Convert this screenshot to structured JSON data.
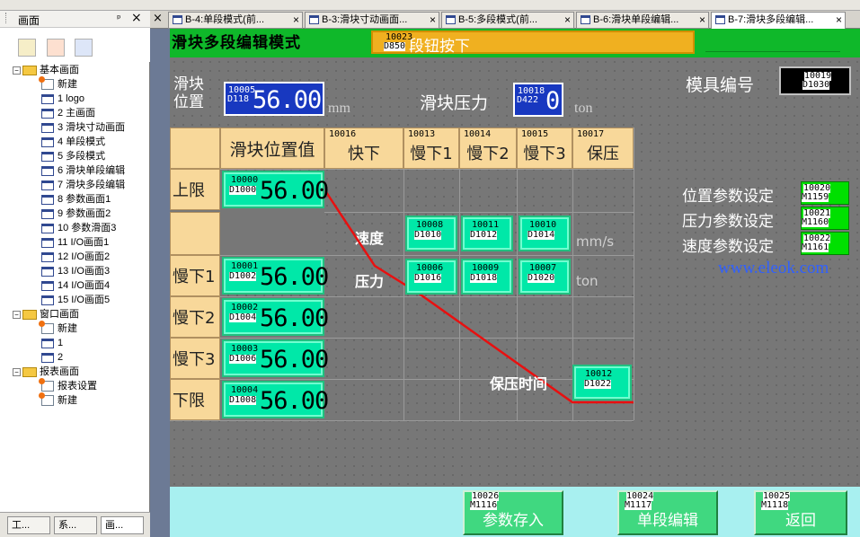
{
  "left_panel": {
    "title": "画面",
    "pin": "ᵖ",
    "close": "×",
    "tree": [
      {
        "label": "基本画面",
        "kind": "folder",
        "level": 0,
        "expander": "⊟"
      },
      {
        "label": "新建",
        "kind": "new",
        "level": 1
      },
      {
        "label": "1 logo",
        "kind": "page",
        "level": 1
      },
      {
        "label": "2 主画面",
        "kind": "page",
        "level": 1
      },
      {
        "label": "3 滑块寸动画面",
        "kind": "page",
        "level": 1
      },
      {
        "label": "4 单段模式",
        "kind": "page",
        "level": 1
      },
      {
        "label": "5 多段模式",
        "kind": "page",
        "level": 1
      },
      {
        "label": "6 滑块单段编辑",
        "kind": "page",
        "level": 1
      },
      {
        "label": "7 滑块多段编辑",
        "kind": "page",
        "level": 1
      },
      {
        "label": "8 参数画面1",
        "kind": "page",
        "level": 1
      },
      {
        "label": "9 参数画面2",
        "kind": "page",
        "level": 1
      },
      {
        "label": "10 参数滑面3",
        "kind": "page",
        "level": 1
      },
      {
        "label": "11 I/O画面1",
        "kind": "page",
        "level": 1
      },
      {
        "label": "12 I/O画面2",
        "kind": "page",
        "level": 1
      },
      {
        "label": "13 I/O画面3",
        "kind": "page",
        "level": 1
      },
      {
        "label": "14 I/O画面4",
        "kind": "page",
        "level": 1
      },
      {
        "label": "15 I/O画面5",
        "kind": "page",
        "level": 1
      },
      {
        "label": "窗口画面",
        "kind": "folder",
        "level": 0,
        "expander": "⊟"
      },
      {
        "label": "新建",
        "kind": "new",
        "level": 1
      },
      {
        "label": "1",
        "kind": "page",
        "level": 1
      },
      {
        "label": "2",
        "kind": "page",
        "level": 1
      },
      {
        "label": "报表画面",
        "kind": "folder",
        "level": 0,
        "expander": "⊟"
      },
      {
        "label": "报表设置",
        "kind": "report",
        "level": 1
      },
      {
        "label": "新建",
        "kind": "new",
        "level": 1
      }
    ],
    "bottom_tabs": [
      "工...",
      "系...",
      "画..."
    ]
  },
  "tabs": [
    {
      "label": "B-4:单段模式(前..."
    },
    {
      "label": "B-3:滑块寸动画面..."
    },
    {
      "label": "B-5:多段模式(前..."
    },
    {
      "label": "B-6:滑块单段编辑..."
    },
    {
      "label": "B-7:滑块多段编辑...",
      "active": true
    }
  ],
  "screen": {
    "title": "滑块多段编辑模式",
    "status_tag": "10023",
    "status_tag2": "D850",
    "status_text": "段钮按下",
    "slider_pos_label": "滑块\n位置",
    "slider_pos_tag": "10005",
    "slider_pos_reg": "D118",
    "slider_pos_value": "56.00",
    "slider_pos_unit": "mm",
    "slider_press_label": "滑块压力",
    "slider_press_tag": "10018",
    "slider_press_reg": "D422",
    "slider_press_value": "0",
    "slider_press_unit": "ton",
    "mold_label": "模具编号",
    "mold_tag": "10019",
    "mold_reg": "D1030",
    "table": {
      "header_col0": "滑块位置值",
      "columns": [
        {
          "tag": "10016",
          "label": "快下"
        },
        {
          "tag": "10013",
          "label": "慢下1"
        },
        {
          "tag": "10014",
          "label": "慢下2"
        },
        {
          "tag": "10015",
          "label": "慢下3"
        },
        {
          "tag": "10017",
          "label": "保压"
        }
      ],
      "rows": [
        {
          "label": "上限",
          "tag": "10000",
          "reg": "D1000",
          "value": "56.00"
        },
        {
          "label": "慢下1",
          "tag": "10001",
          "reg": "D1002",
          "value": "56.00"
        },
        {
          "label": "慢下2",
          "tag": "10002",
          "reg": "D1004",
          "value": "56.00"
        },
        {
          "label": "慢下3",
          "tag": "10003",
          "reg": "D1006",
          "value": "56.00"
        },
        {
          "label": "下限",
          "tag": "10004",
          "reg": "D1008",
          "value": "56.00"
        }
      ]
    },
    "speed_label": "速度",
    "speed_unit": "mm/s",
    "speed_fields": [
      {
        "tag": "10008",
        "reg": "D1010"
      },
      {
        "tag": "10011",
        "reg": "D1012"
      },
      {
        "tag": "10010",
        "reg": "D1014"
      }
    ],
    "press_label": "压力",
    "press_unit": "ton",
    "press_fields": [
      {
        "tag": "10006",
        "reg": "D1016"
      },
      {
        "tag": "10009",
        "reg": "D1018"
      },
      {
        "tag": "10007",
        "reg": "D1020"
      }
    ],
    "hold_label": "保压时间",
    "hold_tag": "10012",
    "hold_reg": "D1022",
    "params": [
      {
        "label": "位置参数设定",
        "tag": "10020",
        "reg": "M1159"
      },
      {
        "label": "压力参数设定",
        "tag": "10021",
        "reg": "M1160"
      },
      {
        "label": "速度参数设定",
        "tag": "10022",
        "reg": "M1161"
      }
    ],
    "watermark": "www.eleok.com",
    "buttons": [
      {
        "tag": "10026",
        "reg": "M1116",
        "label": "参数存入"
      },
      {
        "tag": "10024",
        "reg": "M1117",
        "label": "单段编辑"
      },
      {
        "tag": "10025",
        "reg": "M1118",
        "label": "返回"
      }
    ]
  },
  "colors": {
    "title_green": "#0fb82a",
    "field_green": "#00e8a8",
    "header_yellow": "#f8d89a",
    "bottom_cyan": "#a8f0f0",
    "blue_field": "#1838c0"
  }
}
